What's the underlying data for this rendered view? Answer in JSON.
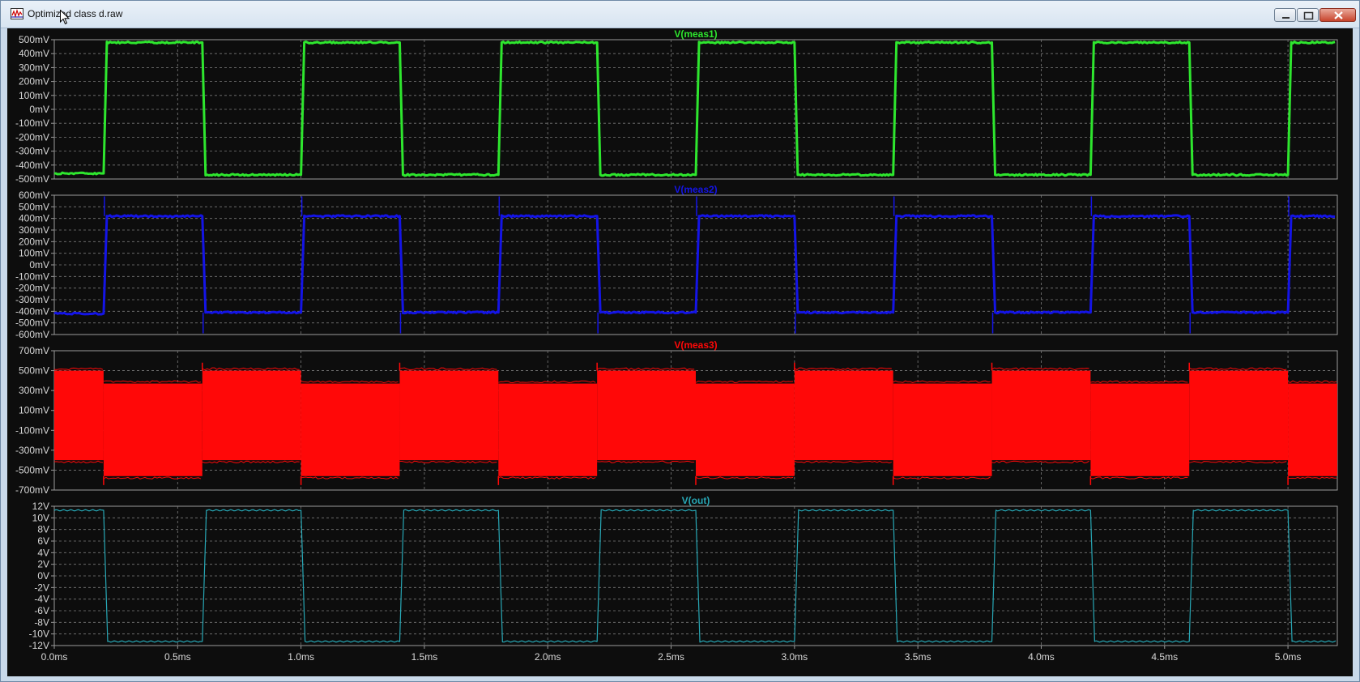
{
  "window": {
    "title": "Optimized class d.raw",
    "controls": {
      "minimize": "minimize",
      "maximize": "maximize",
      "close": "close"
    }
  },
  "colors": {
    "background": "#0d0d0d",
    "grid": "#7a7a7a",
    "border": "#9a9a9a",
    "label": "#d8d8d8",
    "meas1": "#2ee62e",
    "meas2": "#1414e6",
    "meas3": "#ff0808",
    "out": "#27a7b5"
  },
  "x_axis": {
    "ticks": [
      "0.0ms",
      "0.5ms",
      "1.0ms",
      "1.5ms",
      "2.0ms",
      "2.5ms",
      "3.0ms",
      "3.5ms",
      "4.0ms",
      "4.5ms",
      "5.0ms"
    ],
    "tick_values_ms": [
      0,
      0.5,
      1,
      1.5,
      2,
      2.5,
      3,
      3.5,
      4,
      4.5,
      5
    ],
    "range_ms": [
      0,
      5.2
    ]
  },
  "chart_data": [
    {
      "type": "line",
      "title": "V(meas1)",
      "ylim": [
        -500,
        500
      ],
      "yticks": [
        "500mV",
        "400mV",
        "300mV",
        "200mV",
        "100mV",
        "0mV",
        "-100mV",
        "-200mV",
        "-300mV",
        "-400mV",
        "-500mV"
      ],
      "series": [
        {
          "name": "V(meas1)",
          "x_ms": [
            0,
            0.2,
            0.6,
            1.0,
            1.4,
            1.8,
            2.2,
            2.6,
            3.0,
            3.4,
            3.8,
            4.2,
            4.6,
            5.0,
            5.2
          ],
          "levels": [
            -460,
            480,
            -470,
            480,
            -470,
            480,
            -470,
            480,
            -470,
            480,
            -470,
            480,
            -470,
            480
          ],
          "thickness": "medium"
        }
      ]
    },
    {
      "type": "line",
      "title": "V(meas2)",
      "ylim": [
        -600,
        600
      ],
      "yticks": [
        "600mV",
        "500mV",
        "400mV",
        "300mV",
        "200mV",
        "100mV",
        "0mV",
        "-100mV",
        "-200mV",
        "-300mV",
        "-400mV",
        "-500mV",
        "-600mV"
      ],
      "series": [
        {
          "name": "V(meas2)",
          "x_ms": [
            0,
            0.2,
            0.6,
            1.0,
            1.4,
            1.8,
            2.2,
            2.6,
            3.0,
            3.4,
            3.8,
            4.2,
            4.6,
            5.0,
            5.2
          ],
          "levels": [
            -420,
            420,
            -410,
            420,
            -410,
            420,
            -410,
            420,
            -410,
            420,
            -410,
            420,
            -410,
            420
          ],
          "spike": 590,
          "thickness": "medium"
        }
      ]
    },
    {
      "type": "area",
      "title": "V(meas3)",
      "ylim": [
        -700,
        700
      ],
      "yticks": [
        "700mV",
        "500mV",
        "300mV",
        "100mV",
        "-100mV",
        "-300mV",
        "-500mV",
        "-700mV"
      ],
      "series": [
        {
          "name": "V(meas3)",
          "x_ms": [
            0,
            0.2,
            0.6,
            1.0,
            1.4,
            1.8,
            2.2,
            2.6,
            3.0,
            3.4,
            3.8,
            4.2,
            4.6,
            5.0,
            5.2
          ],
          "bands": [
            [
              -400,
              500
            ],
            [
              -560,
              370
            ],
            [
              -400,
              500
            ],
            [
              -560,
              370
            ],
            [
              -400,
              500
            ],
            [
              -560,
              370
            ],
            [
              -400,
              500
            ],
            [
              -560,
              370
            ],
            [
              -400,
              500
            ],
            [
              -560,
              370
            ],
            [
              -400,
              500
            ],
            [
              -560,
              370
            ],
            [
              -400,
              500
            ],
            [
              -560,
              370
            ]
          ]
        }
      ]
    },
    {
      "type": "line",
      "title": "V(out)",
      "ylim": [
        -12,
        12
      ],
      "yticks": [
        "12V",
        "10V",
        "8V",
        "6V",
        "4V",
        "2V",
        "0V",
        "-2V",
        "-4V",
        "-6V",
        "-8V",
        "-10V",
        "-12V"
      ],
      "series": [
        {
          "name": "V(out)",
          "x_ms": [
            0,
            0.2,
            0.6,
            1.0,
            1.4,
            1.8,
            2.2,
            2.6,
            3.0,
            3.4,
            3.8,
            4.2,
            4.6,
            5.0,
            5.2
          ],
          "levels": [
            11.3,
            -11.3,
            11.3,
            -11.3,
            11.3,
            -11.3,
            11.3,
            -11.3,
            11.3,
            -11.3,
            11.3,
            -11.3,
            11.3,
            -11.3
          ],
          "thickness": "thin"
        }
      ]
    }
  ]
}
